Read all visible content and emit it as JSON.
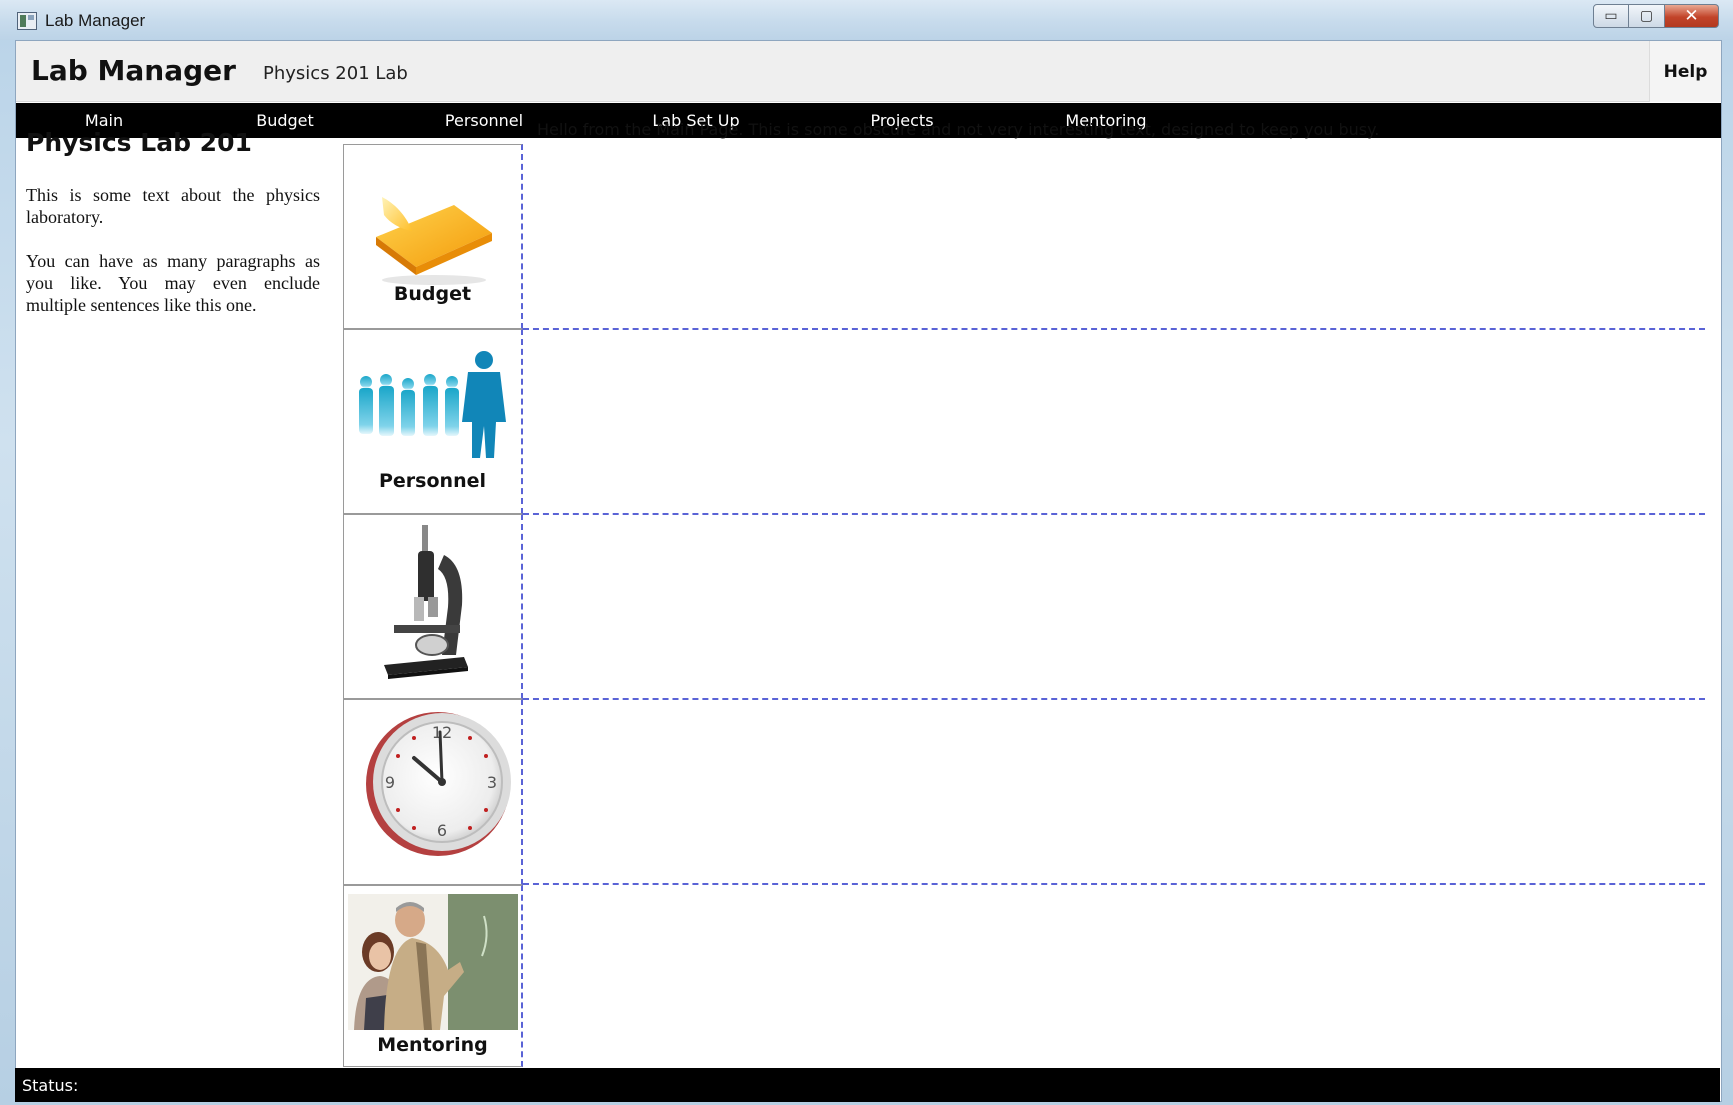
{
  "window": {
    "title": "Lab Manager",
    "minimize_glyph": "▭",
    "maximize_glyph": "▢",
    "close_glyph": "✕"
  },
  "header": {
    "app_name": "Lab Manager",
    "lab_name": "Physics 201 Lab",
    "help_label": "Help"
  },
  "nav": {
    "items": [
      {
        "label": "Main"
      },
      {
        "label": "Budget"
      },
      {
        "label": "Personnel"
      },
      {
        "label": "Lab Set Up"
      },
      {
        "label": "Projects"
      },
      {
        "label": "Mentoring"
      }
    ]
  },
  "left_panel": {
    "title": "Physics Lab 201",
    "paragraphs": [
      "This is some text about the physics laboratory.",
      "You can have as many paragraphs as you like. You may even enclude multiple sentences like this one."
    ]
  },
  "tiles": [
    {
      "label": "Budget",
      "icon": "sticky-note-icon"
    },
    {
      "label": "Personnel",
      "icon": "people-silhouettes-icon"
    },
    {
      "label": "",
      "icon": "microscope-icon"
    },
    {
      "label": "",
      "icon": "clock-icon"
    },
    {
      "label": "Mentoring",
      "icon": "teacher-student-photo"
    }
  ],
  "main": {
    "hello_text": "Hello from the Main Page. This is some obscure and not very interesting text, designed to keep you busy."
  },
  "status": {
    "label": "Status:"
  },
  "colors": {
    "nav_bg": "#000000",
    "status_bg": "#000000",
    "dash_accent": "#5a63d6",
    "header_bg": "#efefef"
  }
}
